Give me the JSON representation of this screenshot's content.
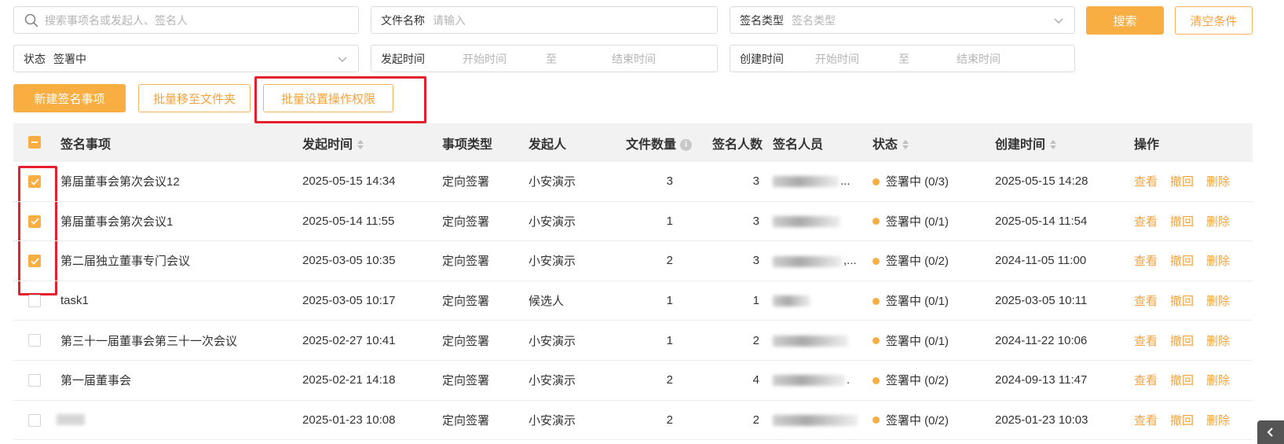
{
  "filters": {
    "search_placeholder": "搜索事项名或发起人、签名人",
    "file_name_label": "文件名称",
    "file_name_placeholder": "请输入",
    "sign_type_label": "签名类型",
    "sign_type_placeholder": "签名类型",
    "status_label": "状态",
    "status_value": "签署中",
    "start_time_label": "发起时间",
    "start_time_begin": "开始时间",
    "start_time_to": "至",
    "start_time_end": "结束时间",
    "create_time_label": "创建时间",
    "create_time_begin": "开始时间",
    "create_time_to": "至",
    "create_time_end": "结束时间",
    "search_button": "搜索",
    "clear_button": "清空条件"
  },
  "toolbar": {
    "new_button": "新建签名事项",
    "move_button": "批量移至文件夹",
    "permission_button": "批量设置操作权限"
  },
  "table": {
    "headers": {
      "item": "签名事项",
      "start_time": "发起时间",
      "type": "事项类型",
      "initiator": "发起人",
      "file_count": "文件数量",
      "signer_count": "签名人数",
      "signers": "签名人员",
      "status": "状态",
      "created": "创建时间",
      "actions": "操作"
    },
    "actions": {
      "view": "查看",
      "revoke": "撤回",
      "delete": "删除"
    },
    "rows": [
      {
        "checked": true,
        "item": "第届董事会第次会议12",
        "start_time": "2025-05-15 14:34",
        "type": "定向签署",
        "initiator": "小安演示",
        "file_count": "3",
        "signer_count": "3",
        "signers_suffix": "...",
        "status": "签署中 (0/3)",
        "created": "2025-05-15 14:28"
      },
      {
        "checked": true,
        "item": "第届董事会第次会议1",
        "start_time": "2025-05-14 11:55",
        "type": "定向签署",
        "initiator": "小安演示",
        "file_count": "1",
        "signer_count": "3",
        "signers_suffix": "",
        "status": "签署中 (0/1)",
        "created": "2025-05-14 11:54"
      },
      {
        "checked": true,
        "item": "第二届独立董事专门会议",
        "start_time": "2025-03-05 10:35",
        "type": "定向签署",
        "initiator": "小安演示",
        "file_count": "2",
        "signer_count": "3",
        "signers_suffix": ",...",
        "status": "签署中 (0/2)",
        "created": "2024-11-05 11:00"
      },
      {
        "checked": false,
        "item": "task1",
        "start_time": "2025-03-05 10:17",
        "type": "定向签署",
        "initiator": "候选人",
        "file_count": "1",
        "signer_count": "1",
        "signers_suffix": "",
        "status": "签署中 (0/1)",
        "created": "2025-03-05 10:11"
      },
      {
        "checked": false,
        "item": "第三十一届董事会第三十一次会议",
        "start_time": "2025-02-27 10:41",
        "type": "定向签署",
        "initiator": "小安演示",
        "file_count": "1",
        "signer_count": "2",
        "signers_suffix": "",
        "status": "签署中 (0/1)",
        "created": "2024-11-22 10:06"
      },
      {
        "checked": false,
        "item": "第一届董事会",
        "start_time": "2025-02-21 14:18",
        "type": "定向签署",
        "initiator": "小安演示",
        "file_count": "2",
        "signer_count": "4",
        "signers_suffix": ".",
        "status": "签署中 (0/2)",
        "created": "2024-09-13 11:47"
      },
      {
        "checked": false,
        "item": "",
        "start_time": "2025-01-23 10:08",
        "type": "定向签署",
        "initiator": "小安演示",
        "file_count": "2",
        "signer_count": "2",
        "signers_suffix": "",
        "status": "签署中 (0/2)",
        "created": "2025-01-23 10:03"
      }
    ]
  },
  "colors": {
    "accent": "#f9ae41",
    "highlight": "#e5202e"
  }
}
